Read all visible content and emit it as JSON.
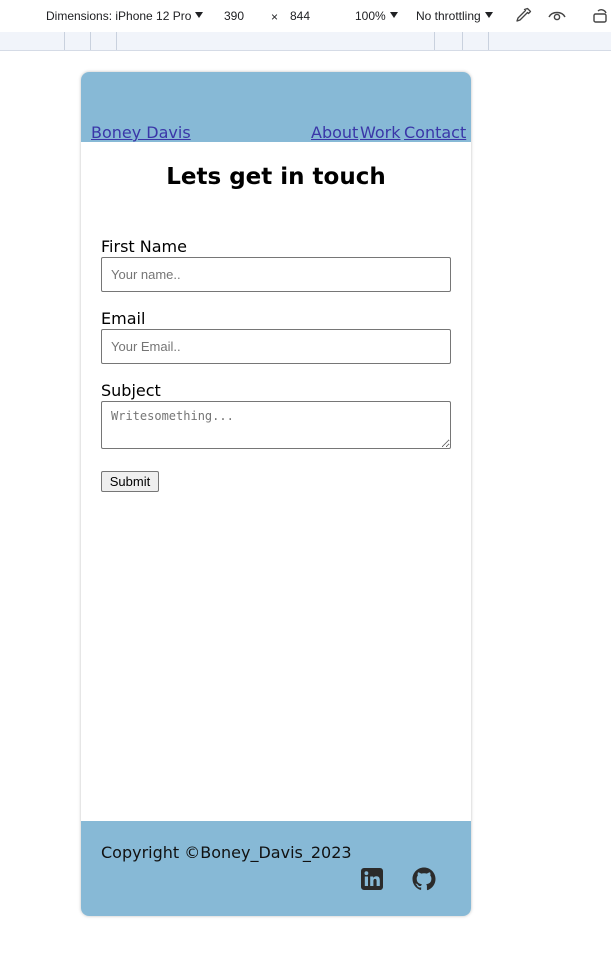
{
  "devtools": {
    "dimensions_label": "Dimensions: iPhone 12 Pro",
    "width_value": "390",
    "times_sign": "×",
    "height_value": "844",
    "zoom_label": "100%",
    "throttle_label": "No throttling",
    "icons": [
      "eyedropper-icon",
      "eye-icon",
      "rotate-icon"
    ]
  },
  "site": {
    "brand": "Boney Davis",
    "nav": [
      {
        "label": "About"
      },
      {
        "label": "Work"
      },
      {
        "label": "Contact"
      }
    ],
    "accent_color": "#87b9d6",
    "link_color": "#3a36a8"
  },
  "contact": {
    "title": "Lets get in touch",
    "first_name_label": "First Name",
    "first_name_placeholder": "Your name..",
    "email_label": "Email",
    "email_placeholder": "Your Email..",
    "subject_label": "Subject",
    "subject_placeholder": "Writesomething...",
    "submit_label": "Submit"
  },
  "footer": {
    "copyright": "Copyright ©Boney_Davis_2023",
    "icons": [
      "linkedin-icon",
      "github-icon"
    ]
  }
}
